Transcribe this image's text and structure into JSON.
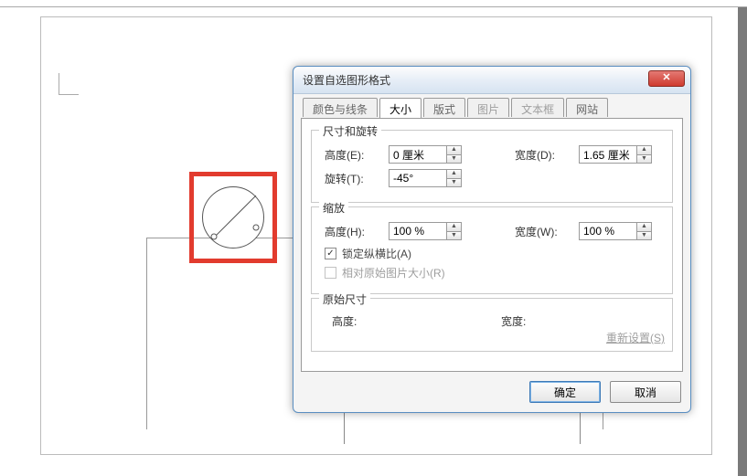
{
  "dialog": {
    "title": "设置自选图形格式",
    "tabs": {
      "colors_lines": "颜色与线条",
      "size": "大小",
      "layout": "版式",
      "picture": "图片",
      "textbox": "文本框",
      "web": "网站"
    },
    "groups": {
      "size_rotate": {
        "legend": "尺寸和旋转",
        "height_label": "高度(E):",
        "height_value": "0 厘米",
        "width_label": "宽度(D):",
        "width_value": "1.65 厘米",
        "rotate_label": "旋转(T):",
        "rotate_value": "-45°"
      },
      "scale": {
        "legend": "缩放",
        "height_label": "高度(H):",
        "height_value": "100 %",
        "width_label": "宽度(W):",
        "width_value": "100 %",
        "lock_ratio_label": "锁定纵横比(A)",
        "lock_ratio_checked": true,
        "relative_label": "相对原始图片大小(R)"
      },
      "original": {
        "legend": "原始尺寸",
        "height_label": "高度:",
        "width_label": "宽度:"
      }
    },
    "reset": "重新设置(S)",
    "ok": "确定",
    "cancel": "取消"
  }
}
